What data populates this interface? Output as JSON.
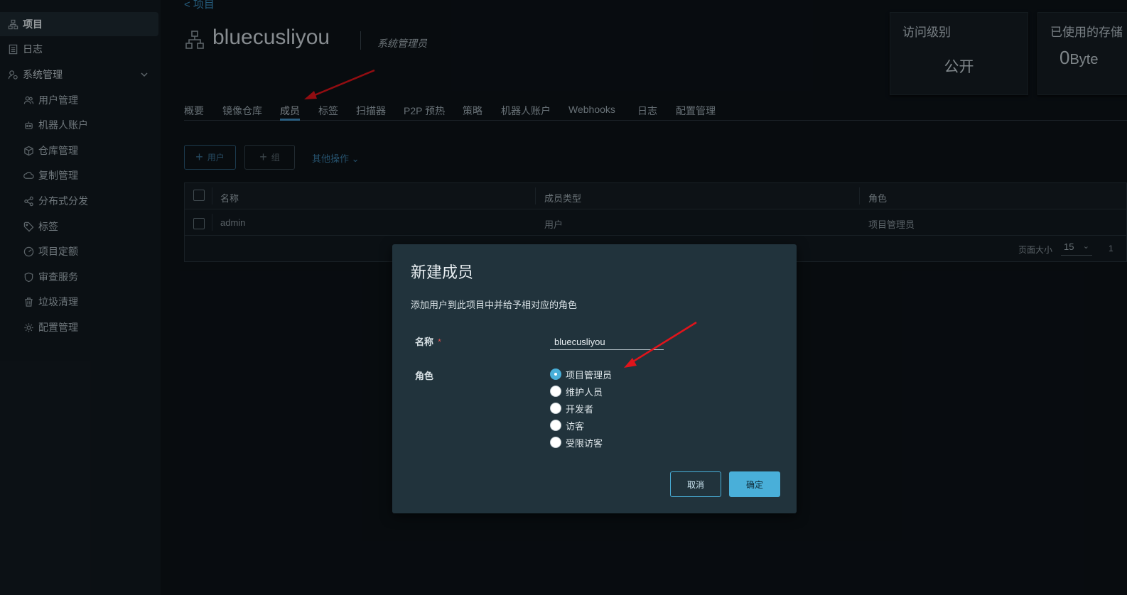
{
  "sidebar": {
    "items": [
      {
        "label": "项目",
        "icon": "project-icon"
      },
      {
        "label": "日志",
        "icon": "log-icon"
      },
      {
        "label": "系统管理",
        "icon": "system-admin-icon"
      }
    ],
    "sub_items": [
      {
        "label": "用户管理",
        "icon": "users-icon"
      },
      {
        "label": "机器人账户",
        "icon": "robot-icon"
      },
      {
        "label": "仓库管理",
        "icon": "registry-icon"
      },
      {
        "label": "复制管理",
        "icon": "replication-icon"
      },
      {
        "label": "分布式分发",
        "icon": "share-icon"
      },
      {
        "label": "标签",
        "icon": "tag-icon"
      },
      {
        "label": "项目定额",
        "icon": "quota-icon"
      },
      {
        "label": "审查服务",
        "icon": "shield-icon"
      },
      {
        "label": "垃圾清理",
        "icon": "trash-icon"
      },
      {
        "label": "配置管理",
        "icon": "gear-icon"
      }
    ]
  },
  "header": {
    "back_link": "<  项目",
    "project_name": "bluecusliyou",
    "user_role": "系统管理员"
  },
  "cards": {
    "access_title": "访问级别",
    "access_value": "公开",
    "storage_title": "已使用的存储",
    "storage_value": "0",
    "storage_unit": "Byte"
  },
  "tabs": [
    "概要",
    "镜像仓库",
    "成员",
    "标签",
    "扫描器",
    "P2P 预热",
    "策略",
    "机器人账户",
    "Webhooks",
    "日志",
    "配置管理"
  ],
  "active_tab": "成员",
  "toolbar": {
    "add_user": "用户",
    "add_group": "组",
    "more_ops": "其他操作"
  },
  "table": {
    "columns": [
      "名称",
      "成员类型",
      "角色"
    ],
    "rows": [
      {
        "name": "admin",
        "type": "用户",
        "role": "项目管理员"
      }
    ],
    "page_size_label": "页面大小",
    "page_size": "15",
    "page_num": "1"
  },
  "modal": {
    "title": "新建成员",
    "description": "添加用户到此项目中并给予相对应的角色",
    "name_label": "名称",
    "name_value": "bluecusliyou",
    "role_label": "角色",
    "roles": [
      "项目管理员",
      "维护人员",
      "开发者",
      "访客",
      "受限访客"
    ],
    "selected_role": "项目管理员",
    "cancel": "取消",
    "ok": "确定"
  },
  "colors": {
    "accent": "#49afd9",
    "annotation_arrow": "#e0141b",
    "background": "#0d1318",
    "modal_bg": "#21333c"
  }
}
